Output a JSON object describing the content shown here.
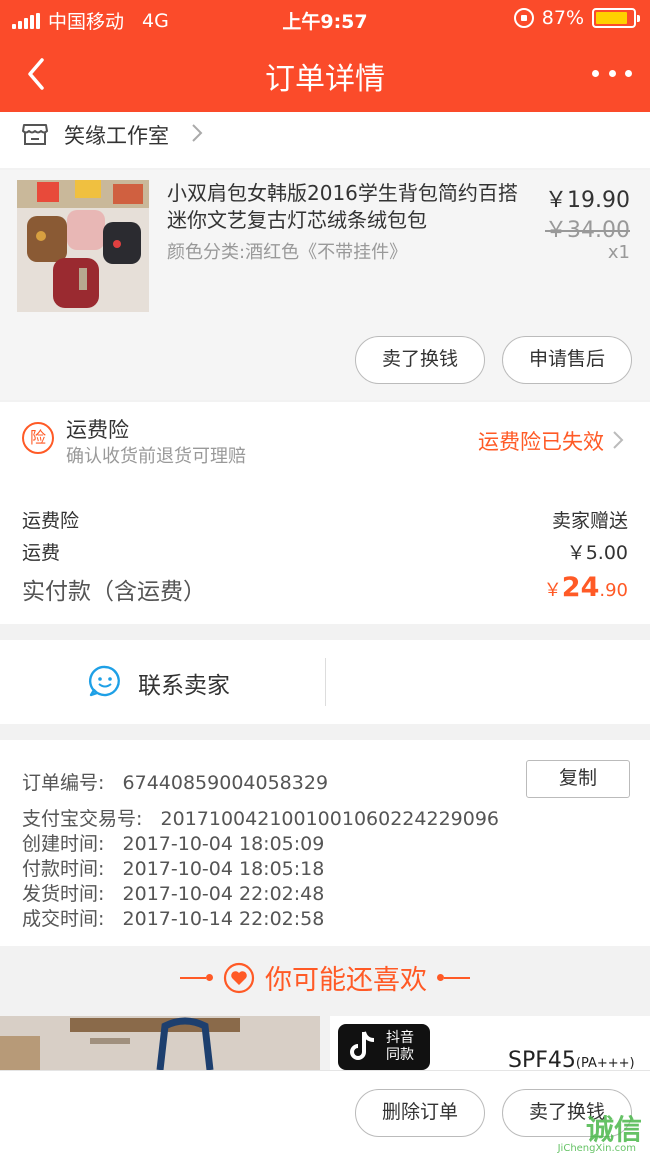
{
  "status_bar": {
    "carrier": "中国移动",
    "network": "4G",
    "time": "上午9:57",
    "battery": "87%"
  },
  "nav": {
    "title": "订单详情"
  },
  "shop": {
    "name": "笑缘工作室"
  },
  "product": {
    "title": "小双肩包女韩版2016学生背包简约百搭迷你文艺复古灯芯绒条绒包包",
    "sku": "颜色分类:酒红色《不带挂件》",
    "price": "￥19.90",
    "original_price": "￥34.00",
    "qty": "x1",
    "buttons": {
      "sell": "卖了换钱",
      "aftersale": "申请售后"
    }
  },
  "insurance": {
    "icon_text": "险",
    "title": "运费险",
    "subtitle": "确认收货前退货可理赔",
    "status": "运费险已失效"
  },
  "fees": {
    "insurance_label": "运费险",
    "insurance_value": "卖家赠送",
    "shipping_label": "运费",
    "shipping_value": "￥5.00",
    "total_label": "实付款（含运费）",
    "total_currency": "￥",
    "total_int": "24",
    "total_dec": ".90"
  },
  "contact": {
    "label": "联系卖家"
  },
  "order": {
    "copy_label": "复制",
    "rows": [
      {
        "label": "订单编号:",
        "value": "67440859004058329"
      },
      {
        "label": "支付宝交易号:",
        "value": "2017100421001001060224229096"
      },
      {
        "label": "创建时间:",
        "value": "2017-10-04 18:05:09"
      },
      {
        "label": "付款时间:",
        "value": "2017-10-04 18:05:18"
      },
      {
        "label": "发货时间:",
        "value": "2017-10-04 22:02:48"
      },
      {
        "label": "成交时间:",
        "value": "2017-10-14 22:02:58"
      }
    ]
  },
  "recommend": {
    "title": "你可能还喜欢",
    "tiktok_label": "抖音同款",
    "spf": "SPF45",
    "spf_sub": "(PA+++)"
  },
  "bottom": {
    "delete": "删除订单",
    "sell": "卖了换钱"
  },
  "watermark": {
    "main": "诚信",
    "sub": "JiChengXin.com"
  },
  "colors": {
    "brand": "#fb4b2a",
    "accent": "#ff5a26",
    "battery": "#ffd000"
  }
}
